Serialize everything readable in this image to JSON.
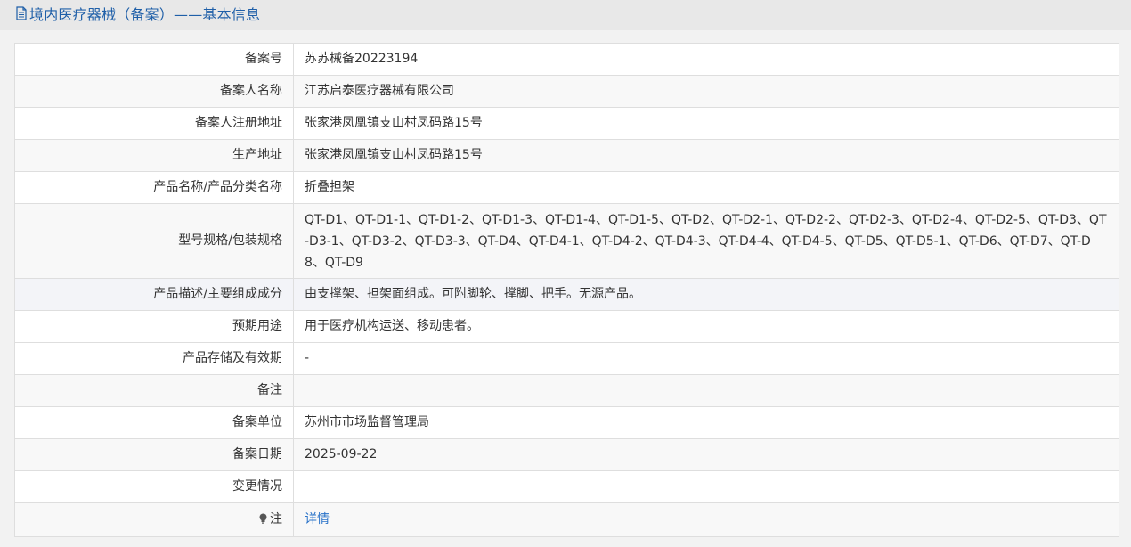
{
  "header": {
    "title": "境内医疗器械（备案）——基本信息",
    "icon": "document-icon",
    "color": "#1f5fa8"
  },
  "rows": [
    {
      "label": "备案号",
      "value": "苏苏械备20223194"
    },
    {
      "label": "备案人名称",
      "value": "江苏启泰医疗器械有限公司"
    },
    {
      "label": "备案人注册地址",
      "value": "张家港凤凰镇支山村凤码路15号"
    },
    {
      "label": "生产地址",
      "value": "张家港凤凰镇支山村凤码路15号"
    },
    {
      "label": "产品名称/产品分类名称",
      "value": "折叠担架"
    },
    {
      "label": "型号规格/包装规格",
      "value": "QT-D1、QT-D1-1、QT-D1-2、QT-D1-3、QT-D1-4、QT-D1-5、QT-D2、QT-D2-1、QT-D2-2、QT-D2-3、QT-D2-4、QT-D2-5、QT-D3、QT-D3-1、QT-D3-2、QT-D3-3、QT-D4、QT-D4-1、QT-D4-2、QT-D4-3、QT-D4-4、QT-D4-5、QT-D5、QT-D5-1、QT-D6、QT-D7、QT-D8、QT-D9"
    },
    {
      "label": "产品描述/主要组成成分",
      "value": "由支撑架、担架面组成。可附脚轮、撑脚、把手。无源产品。"
    },
    {
      "label": "预期用途",
      "value": "用于医疗机构运送、移动患者。"
    },
    {
      "label": "产品存储及有效期",
      "value": "-"
    },
    {
      "label": "备注",
      "value": ""
    },
    {
      "label": "备案单位",
      "value": "苏州市市场监督管理局"
    },
    {
      "label": "备案日期",
      "value": "2025-09-22"
    },
    {
      "label": "变更情况",
      "value": ""
    }
  ],
  "note_row": {
    "label": "注",
    "icon": "lightbulb-icon",
    "link_text": "详情",
    "link_color": "#2a73c9"
  }
}
